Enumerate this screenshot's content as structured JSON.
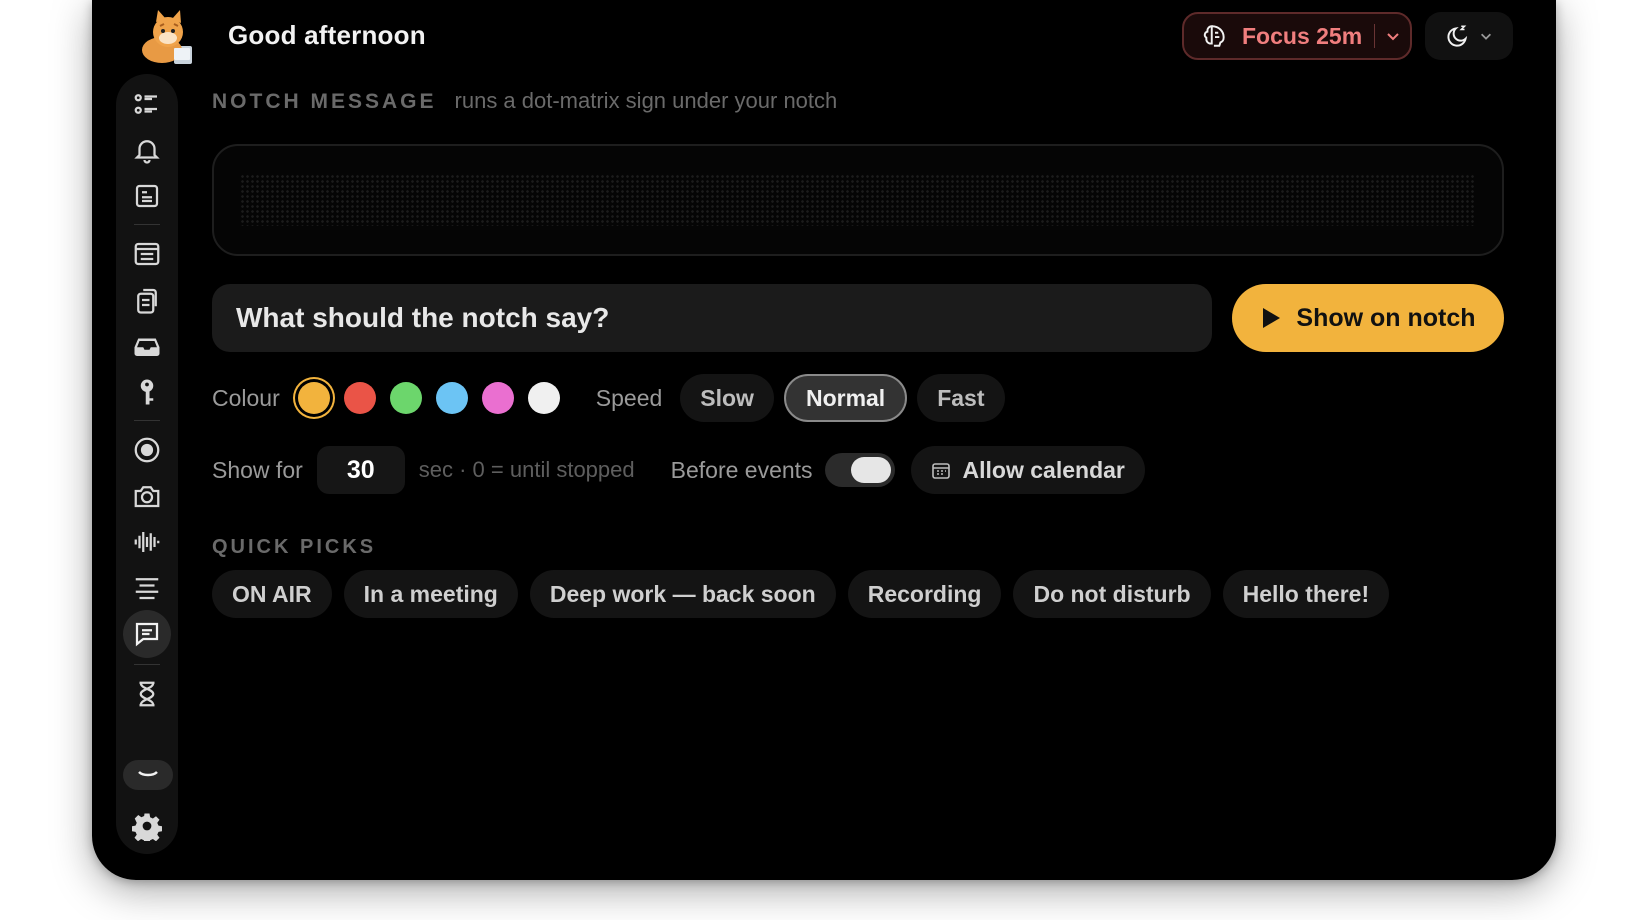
{
  "header": {
    "greeting": "Good afternoon",
    "avatar_icon": "cat-avatar",
    "focus": {
      "label": "Focus 25m",
      "color": "#f07e7e"
    }
  },
  "sidebar": {
    "items": [
      {
        "name": "checklist",
        "icon": "list-icon"
      },
      {
        "name": "notifications",
        "icon": "bell-icon"
      },
      {
        "name": "notes",
        "icon": "note-icon"
      },
      {
        "name": "articles",
        "icon": "document-icon"
      },
      {
        "name": "clipboard",
        "icon": "copy-icon"
      },
      {
        "name": "inbox",
        "icon": "tray-icon"
      },
      {
        "name": "keys",
        "icon": "key-icon"
      },
      {
        "name": "record",
        "icon": "record-icon"
      },
      {
        "name": "camera",
        "icon": "camera-icon"
      },
      {
        "name": "audio",
        "icon": "waveform-icon"
      },
      {
        "name": "text",
        "icon": "text-lines-icon"
      },
      {
        "name": "message",
        "icon": "chat-icon",
        "active": true
      },
      {
        "name": "timer",
        "icon": "hourglass-icon"
      },
      {
        "name": "collapse",
        "icon": "chevron-down-icon"
      },
      {
        "name": "settings",
        "icon": "gear-icon"
      }
    ]
  },
  "section": {
    "title": "NOTCH MESSAGE",
    "subtitle": "runs a dot-matrix sign under your notch"
  },
  "message": {
    "placeholder": "What should the notch say?",
    "value": "",
    "show_button": "Show on notch"
  },
  "colour": {
    "label": "Colour",
    "swatches": [
      "#f2b33d",
      "#ea5447",
      "#6cd66c",
      "#6cc4f4",
      "#ea6fd0",
      "#f0f0f0"
    ],
    "selected": 0
  },
  "speed": {
    "label": "Speed",
    "options": [
      "Slow",
      "Normal",
      "Fast"
    ],
    "selected": "Normal"
  },
  "show_for": {
    "label": "Show for",
    "value": "30",
    "hint": "sec · 0 = until stopped"
  },
  "before_events": {
    "label": "Before events",
    "on": true
  },
  "calendar": {
    "label": "Allow calendar"
  },
  "quick_picks": {
    "title": "QUICK PICKS",
    "items": [
      "ON AIR",
      "In a meeting",
      "Deep work — back soon",
      "Recording",
      "Do not disturb",
      "Hello there!"
    ]
  }
}
